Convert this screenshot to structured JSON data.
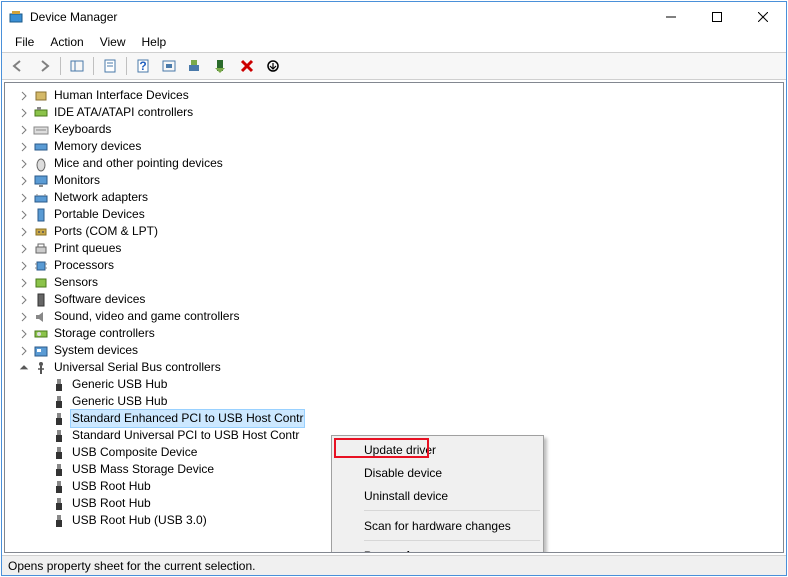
{
  "window": {
    "title": "Device Manager"
  },
  "menubar": [
    "File",
    "Action",
    "View",
    "Help"
  ],
  "tree": {
    "categories": [
      {
        "label": "Human Interface Devices",
        "icon": "hid"
      },
      {
        "label": "IDE ATA/ATAPI controllers",
        "icon": "ide"
      },
      {
        "label": "Keyboards",
        "icon": "keyboard"
      },
      {
        "label": "Memory devices",
        "icon": "memory"
      },
      {
        "label": "Mice and other pointing devices",
        "icon": "mouse"
      },
      {
        "label": "Monitors",
        "icon": "monitor"
      },
      {
        "label": "Network adapters",
        "icon": "network"
      },
      {
        "label": "Portable Devices",
        "icon": "portable"
      },
      {
        "label": "Ports (COM & LPT)",
        "icon": "port"
      },
      {
        "label": "Print queues",
        "icon": "printer"
      },
      {
        "label": "Processors",
        "icon": "cpu"
      },
      {
        "label": "Sensors",
        "icon": "sensor"
      },
      {
        "label": "Software devices",
        "icon": "software"
      },
      {
        "label": "Sound, video and game controllers",
        "icon": "sound"
      },
      {
        "label": "Storage controllers",
        "icon": "storage"
      },
      {
        "label": "System devices",
        "icon": "system"
      },
      {
        "label": "Universal Serial Bus controllers",
        "icon": "usb",
        "expanded": true,
        "children": [
          {
            "label": "Generic USB Hub",
            "icon": "usb-device"
          },
          {
            "label": "Generic USB Hub",
            "icon": "usb-device"
          },
          {
            "label": "Standard Enhanced PCI to USB Host Contr",
            "icon": "usb-device",
            "selected": true
          },
          {
            "label": "Standard Universal PCI to USB Host Contr",
            "icon": "usb-device"
          },
          {
            "label": "USB Composite Device",
            "icon": "usb-device"
          },
          {
            "label": "USB Mass Storage Device",
            "icon": "usb-device"
          },
          {
            "label": "USB Root Hub",
            "icon": "usb-device"
          },
          {
            "label": "USB Root Hub",
            "icon": "usb-device"
          },
          {
            "label": "USB Root Hub (USB 3.0)",
            "icon": "usb-device"
          }
        ]
      }
    ]
  },
  "context_menu": {
    "items": [
      {
        "label": "Update driver",
        "highlighted": true
      },
      {
        "label": "Disable device"
      },
      {
        "label": "Uninstall device"
      },
      {
        "sep": true
      },
      {
        "label": "Scan for hardware changes"
      },
      {
        "sep": true
      },
      {
        "label": "Properties",
        "bold": true
      }
    ]
  },
  "statusbar": {
    "text": "Opens property sheet for the current selection."
  }
}
